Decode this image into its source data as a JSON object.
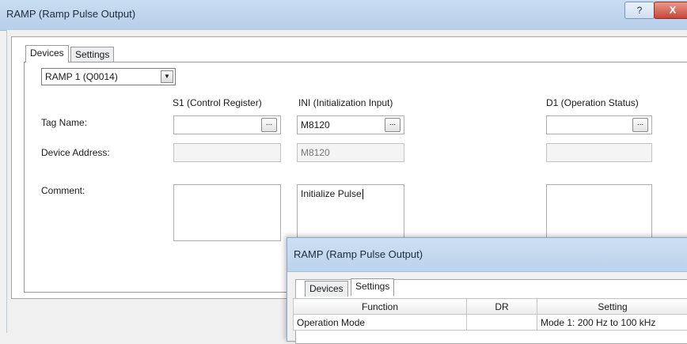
{
  "main_window": {
    "title": "RAMP (Ramp Pulse Output)",
    "help_button": "?",
    "close_button": "X",
    "tabs": [
      "Devices",
      "Settings"
    ],
    "device_select": "RAMP 1 (Q0014)",
    "columns": {
      "s1": "S1 (Control Register)",
      "ini": "INI (Initialization Input)",
      "d1": "D1 (Operation Status)"
    },
    "row_labels": {
      "tag_name": "Tag Name:",
      "device_address": "Device Address:",
      "comment": "Comment:"
    },
    "s1": {
      "tag_name": "",
      "device_address": "",
      "comment": ""
    },
    "ini": {
      "tag_name": "M8120",
      "device_address": "M8120",
      "comment": "Initialize Pulse"
    },
    "d1": {
      "tag_name": "",
      "device_address": "",
      "comment": ""
    },
    "ellipsis": "..."
  },
  "settings_window": {
    "title": "RAMP (Ramp Pulse Output)",
    "tabs": [
      "Devices",
      "Settings"
    ],
    "grid": {
      "headers": [
        "Function",
        "DR",
        "Setting"
      ],
      "rows": [
        [
          "Operation Mode",
          "",
          "Mode 1: 200 Hz to 100 kHz"
        ]
      ]
    }
  }
}
